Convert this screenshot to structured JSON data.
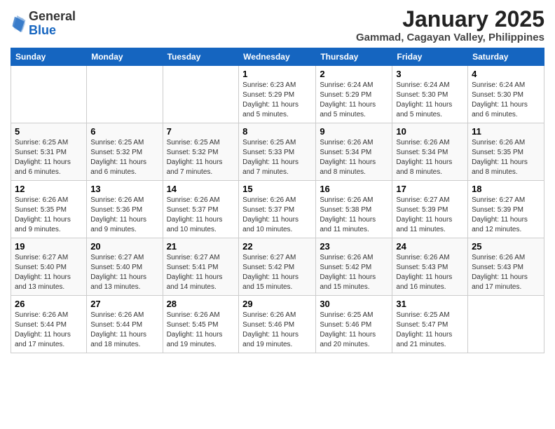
{
  "header": {
    "logo_line1": "General",
    "logo_line2": "Blue",
    "month_title": "January 2025",
    "location": "Gammad, Cagayan Valley, Philippines"
  },
  "weekdays": [
    "Sunday",
    "Monday",
    "Tuesday",
    "Wednesday",
    "Thursday",
    "Friday",
    "Saturday"
  ],
  "weeks": [
    [
      {
        "day": "",
        "info": ""
      },
      {
        "day": "",
        "info": ""
      },
      {
        "day": "",
        "info": ""
      },
      {
        "day": "1",
        "info": "Sunrise: 6:23 AM\nSunset: 5:29 PM\nDaylight: 11 hours\nand 5 minutes."
      },
      {
        "day": "2",
        "info": "Sunrise: 6:24 AM\nSunset: 5:29 PM\nDaylight: 11 hours\nand 5 minutes."
      },
      {
        "day": "3",
        "info": "Sunrise: 6:24 AM\nSunset: 5:30 PM\nDaylight: 11 hours\nand 5 minutes."
      },
      {
        "day": "4",
        "info": "Sunrise: 6:24 AM\nSunset: 5:30 PM\nDaylight: 11 hours\nand 6 minutes."
      }
    ],
    [
      {
        "day": "5",
        "info": "Sunrise: 6:25 AM\nSunset: 5:31 PM\nDaylight: 11 hours\nand 6 minutes."
      },
      {
        "day": "6",
        "info": "Sunrise: 6:25 AM\nSunset: 5:32 PM\nDaylight: 11 hours\nand 6 minutes."
      },
      {
        "day": "7",
        "info": "Sunrise: 6:25 AM\nSunset: 5:32 PM\nDaylight: 11 hours\nand 7 minutes."
      },
      {
        "day": "8",
        "info": "Sunrise: 6:25 AM\nSunset: 5:33 PM\nDaylight: 11 hours\nand 7 minutes."
      },
      {
        "day": "9",
        "info": "Sunrise: 6:26 AM\nSunset: 5:34 PM\nDaylight: 11 hours\nand 8 minutes."
      },
      {
        "day": "10",
        "info": "Sunrise: 6:26 AM\nSunset: 5:34 PM\nDaylight: 11 hours\nand 8 minutes."
      },
      {
        "day": "11",
        "info": "Sunrise: 6:26 AM\nSunset: 5:35 PM\nDaylight: 11 hours\nand 8 minutes."
      }
    ],
    [
      {
        "day": "12",
        "info": "Sunrise: 6:26 AM\nSunset: 5:35 PM\nDaylight: 11 hours\nand 9 minutes."
      },
      {
        "day": "13",
        "info": "Sunrise: 6:26 AM\nSunset: 5:36 PM\nDaylight: 11 hours\nand 9 minutes."
      },
      {
        "day": "14",
        "info": "Sunrise: 6:26 AM\nSunset: 5:37 PM\nDaylight: 11 hours\nand 10 minutes."
      },
      {
        "day": "15",
        "info": "Sunrise: 6:26 AM\nSunset: 5:37 PM\nDaylight: 11 hours\nand 10 minutes."
      },
      {
        "day": "16",
        "info": "Sunrise: 6:26 AM\nSunset: 5:38 PM\nDaylight: 11 hours\nand 11 minutes."
      },
      {
        "day": "17",
        "info": "Sunrise: 6:27 AM\nSunset: 5:39 PM\nDaylight: 11 hours\nand 11 minutes."
      },
      {
        "day": "18",
        "info": "Sunrise: 6:27 AM\nSunset: 5:39 PM\nDaylight: 11 hours\nand 12 minutes."
      }
    ],
    [
      {
        "day": "19",
        "info": "Sunrise: 6:27 AM\nSunset: 5:40 PM\nDaylight: 11 hours\nand 13 minutes."
      },
      {
        "day": "20",
        "info": "Sunrise: 6:27 AM\nSunset: 5:40 PM\nDaylight: 11 hours\nand 13 minutes."
      },
      {
        "day": "21",
        "info": "Sunrise: 6:27 AM\nSunset: 5:41 PM\nDaylight: 11 hours\nand 14 minutes."
      },
      {
        "day": "22",
        "info": "Sunrise: 6:27 AM\nSunset: 5:42 PM\nDaylight: 11 hours\nand 15 minutes."
      },
      {
        "day": "23",
        "info": "Sunrise: 6:26 AM\nSunset: 5:42 PM\nDaylight: 11 hours\nand 15 minutes."
      },
      {
        "day": "24",
        "info": "Sunrise: 6:26 AM\nSunset: 5:43 PM\nDaylight: 11 hours\nand 16 minutes."
      },
      {
        "day": "25",
        "info": "Sunrise: 6:26 AM\nSunset: 5:43 PM\nDaylight: 11 hours\nand 17 minutes."
      }
    ],
    [
      {
        "day": "26",
        "info": "Sunrise: 6:26 AM\nSunset: 5:44 PM\nDaylight: 11 hours\nand 17 minutes."
      },
      {
        "day": "27",
        "info": "Sunrise: 6:26 AM\nSunset: 5:44 PM\nDaylight: 11 hours\nand 18 minutes."
      },
      {
        "day": "28",
        "info": "Sunrise: 6:26 AM\nSunset: 5:45 PM\nDaylight: 11 hours\nand 19 minutes."
      },
      {
        "day": "29",
        "info": "Sunrise: 6:26 AM\nSunset: 5:46 PM\nDaylight: 11 hours\nand 19 minutes."
      },
      {
        "day": "30",
        "info": "Sunrise: 6:25 AM\nSunset: 5:46 PM\nDaylight: 11 hours\nand 20 minutes."
      },
      {
        "day": "31",
        "info": "Sunrise: 6:25 AM\nSunset: 5:47 PM\nDaylight: 11 hours\nand 21 minutes."
      },
      {
        "day": "",
        "info": ""
      }
    ]
  ]
}
